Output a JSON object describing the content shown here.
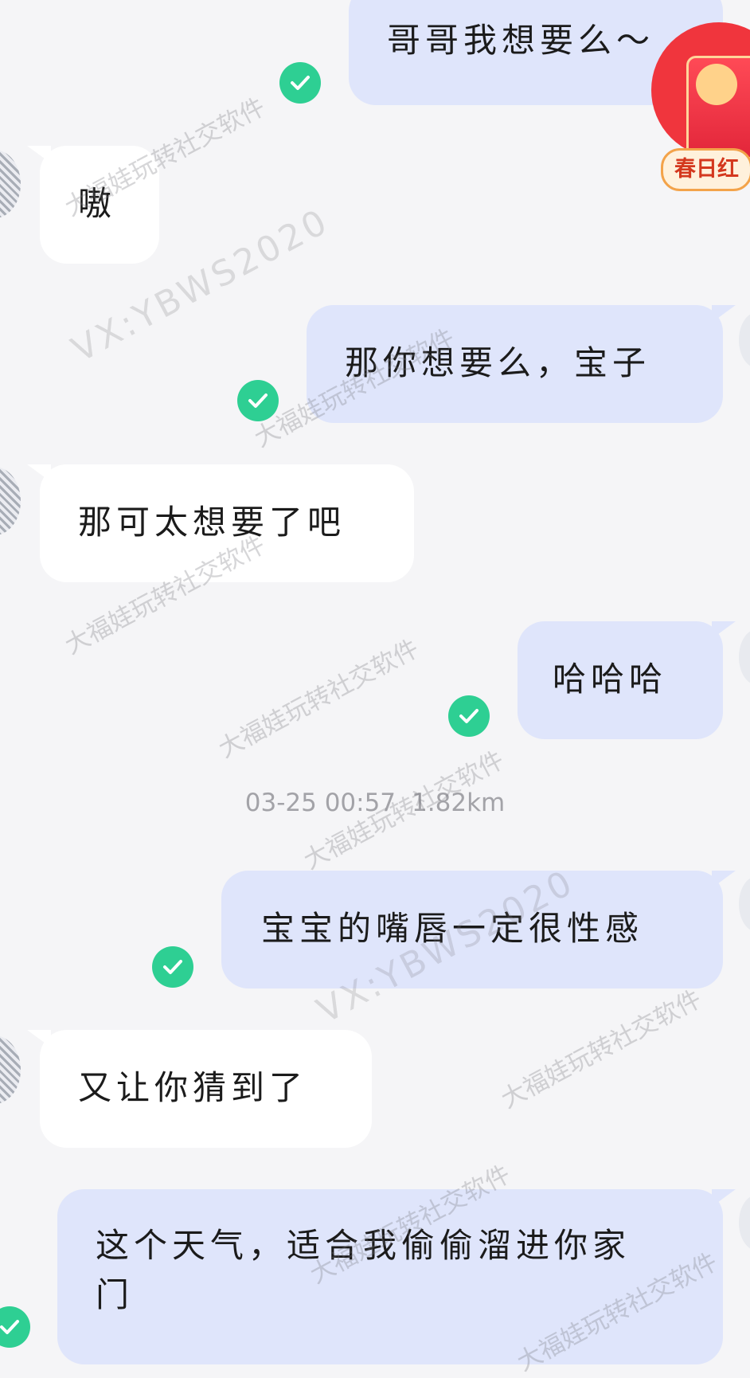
{
  "messages": [
    {
      "from": "me",
      "text": "哥哥我想要么～"
    },
    {
      "from": "them",
      "text": "嗷"
    },
    {
      "from": "me",
      "text": "那你想要么，宝子"
    },
    {
      "from": "them",
      "text": "那可太想要了吧"
    },
    {
      "from": "me",
      "text": "哈哈哈"
    },
    {
      "from": "me",
      "text": "宝宝的嘴唇一定很性感"
    },
    {
      "from": "them",
      "text": "又让你猜到了"
    },
    {
      "from": "me",
      "text": "这个天气，适合我偷偷溜进你家门"
    }
  ],
  "timestamp": {
    "time": "03-25 00:57",
    "distance": "1.82km"
  },
  "red_packet": {
    "label": "春日红"
  },
  "watermark": {
    "main": "大福娃玩转社交软件",
    "contact": "VX:YBWS2020"
  },
  "colors": {
    "my_bubble": "#dfe5fb",
    "their_bubble": "#ffffff",
    "read_check": "#2ecf93",
    "background": "#f5f5f7"
  }
}
